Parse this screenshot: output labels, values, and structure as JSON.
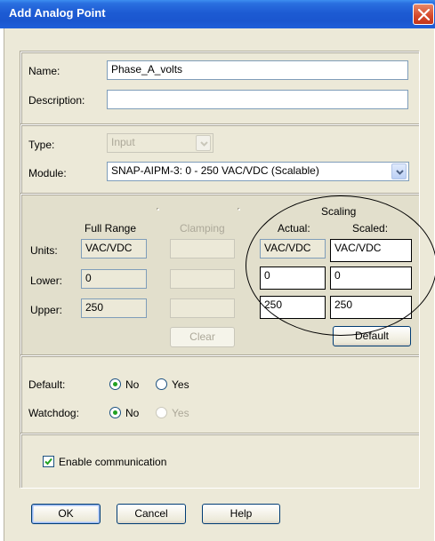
{
  "window": {
    "title": "Add Analog Point"
  },
  "form": {
    "name_label": "Name:",
    "name_value": "Phase_A_volts",
    "description_label": "Description:",
    "description_value": "",
    "type_label": "Type:",
    "type_value": "Input",
    "module_label": "Module:",
    "module_value": "SNAP-AIPM-3: 0 - 250 VAC/VDC (Scalable)"
  },
  "ranges": {
    "scaling_header": "Scaling",
    "full_range_header": "Full Range",
    "clamping_header": "Clamping",
    "actual_header": "Actual:",
    "scaled_header": "Scaled:",
    "units_label": "Units:",
    "lower_label": "Lower:",
    "upper_label": "Upper:",
    "full_range": {
      "units": "VAC/VDC",
      "lower": "0",
      "upper": "250"
    },
    "clamping": {
      "units": "",
      "lower": "",
      "upper": ""
    },
    "actual": {
      "units": "VAC/VDC",
      "lower": "0",
      "upper": "250"
    },
    "scaled": {
      "units": "VAC/VDC",
      "lower": "0",
      "upper": "250"
    },
    "clear_label": "Clear",
    "default_label": "Default"
  },
  "options": {
    "default_label": "Default:",
    "watchdog_label": "Watchdog:",
    "no_label": "No",
    "yes_label": "Yes",
    "default_selected": "No",
    "watchdog_selected": "No",
    "enable_comm_label": "Enable communication",
    "enable_comm_checked": true
  },
  "buttons": {
    "ok": "OK",
    "cancel": "Cancel",
    "help": "Help"
  },
  "colors": {
    "titlebar": "#1d5bd3",
    "dialog_bg": "#ece9d8",
    "radio_dot": "#21a121",
    "close": "#d5482a"
  }
}
